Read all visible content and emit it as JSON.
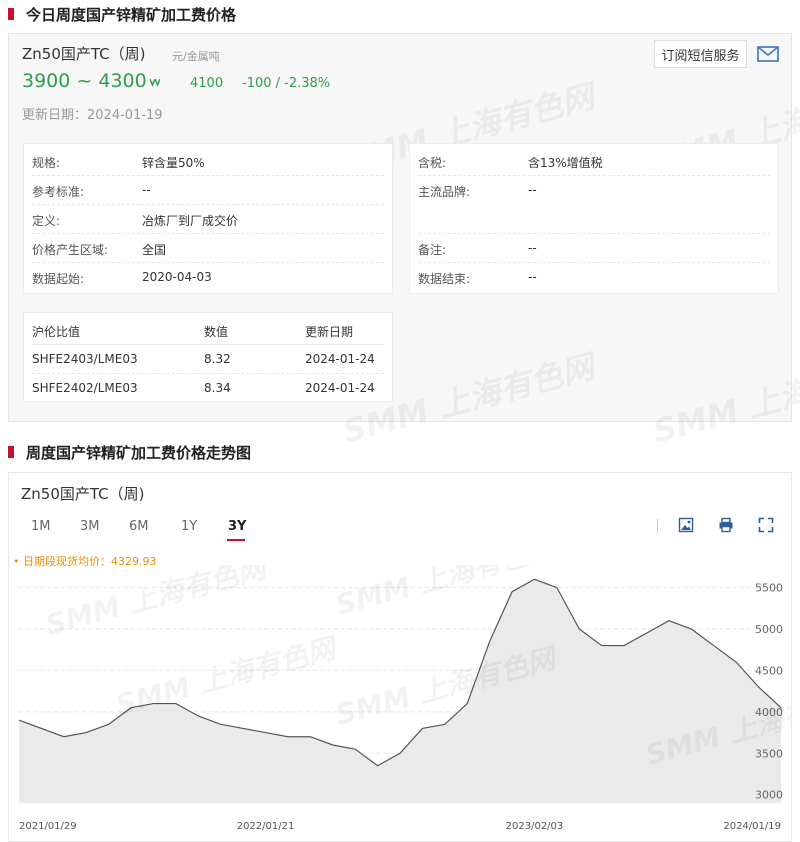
{
  "section1": {
    "title": "今日周度国产锌精矿加工费价格"
  },
  "product": {
    "name": "Zn50国产TC（周)",
    "unit": "元/金属吨",
    "price_range": "3900 ~ 4300",
    "trend_icon": "down-double-arrow-icon",
    "average": "4100",
    "change": "-100 / -2.38%",
    "update_date": "更新日期：2024-01-19",
    "subscribe_label": "订阅短信服务"
  },
  "specs_left": [
    {
      "label": "规格:",
      "value": "锌含量50%"
    },
    {
      "label": "参考标准:",
      "value": "--"
    },
    {
      "label": "定义:",
      "value": "冶炼厂到厂成交价"
    },
    {
      "label": "价格产生区域:",
      "value": "全国"
    },
    {
      "label": "数据起始:",
      "value": "2020-04-03"
    }
  ],
  "specs_right": [
    {
      "label": "含税:",
      "value": "含13%增值税"
    },
    {
      "label": "主流品牌:",
      "value": "--"
    },
    {
      "label": "备注:",
      "value": "--"
    },
    {
      "label": "数据结束:",
      "value": "--"
    }
  ],
  "ratio_table": {
    "headers": [
      "沪伦比值",
      "数值",
      "更新日期"
    ],
    "rows": [
      [
        "SHFE2403/LME03",
        "8.32",
        "2024-01-24"
      ],
      [
        "SHFE2402/LME03",
        "8.34",
        "2024-01-24"
      ]
    ]
  },
  "watermark": "SMM 上海有色网",
  "section2": {
    "title": "周度国产锌精矿加工费价格走势图"
  },
  "chart_panel": {
    "title": "Zn50国产TC（周)",
    "tabs": [
      "1M",
      "3M",
      "6M",
      "1Y",
      "3Y"
    ],
    "active_tab": "3Y",
    "tools": [
      "download-image-icon",
      "print-icon",
      "fullscreen-icon"
    ],
    "avg_label": "• 日期段现货均价：4329.93"
  },
  "chart_data": {
    "type": "area",
    "x_tick_labels": [
      "2021/01/29",
      "2022/01/21",
      "2023/02/03",
      "2024/01/19"
    ],
    "y_ticks": [
      3000,
      3500,
      4000,
      4500,
      5000,
      5500
    ],
    "ylim": [
      2900,
      5700
    ],
    "x": [
      "2021/01/29",
      "2021/03",
      "2021/04",
      "2021/05",
      "2021/06",
      "2021/07",
      "2021/08",
      "2021/09",
      "2021/10",
      "2021/11",
      "2021/12",
      "2022/01/21",
      "2022/02",
      "2022/03",
      "2022/04",
      "2022/05",
      "2022/06",
      "2022/07",
      "2022/08",
      "2022/09",
      "2022/10",
      "2022/11",
      "2022/12",
      "2023/02/03",
      "2023/03",
      "2023/04",
      "2023/05",
      "2023/06",
      "2023/07",
      "2023/08",
      "2023/09",
      "2023/10",
      "2023/11",
      "2023/12",
      "2024/01/19"
    ],
    "values": [
      3900,
      3800,
      3700,
      3750,
      3850,
      4050,
      4100,
      4100,
      3950,
      3850,
      3800,
      3750,
      3700,
      3700,
      3600,
      3550,
      3350,
      3500,
      3800,
      3850,
      4100,
      4850,
      5450,
      5600,
      5500,
      5000,
      4800,
      4800,
      4950,
      5100,
      5000,
      4800,
      4600,
      4300,
      4050
    ],
    "series_color": "#555555",
    "fill_color": "#e8e8e8",
    "grid": true,
    "grid_color": "#e6e6e6"
  }
}
